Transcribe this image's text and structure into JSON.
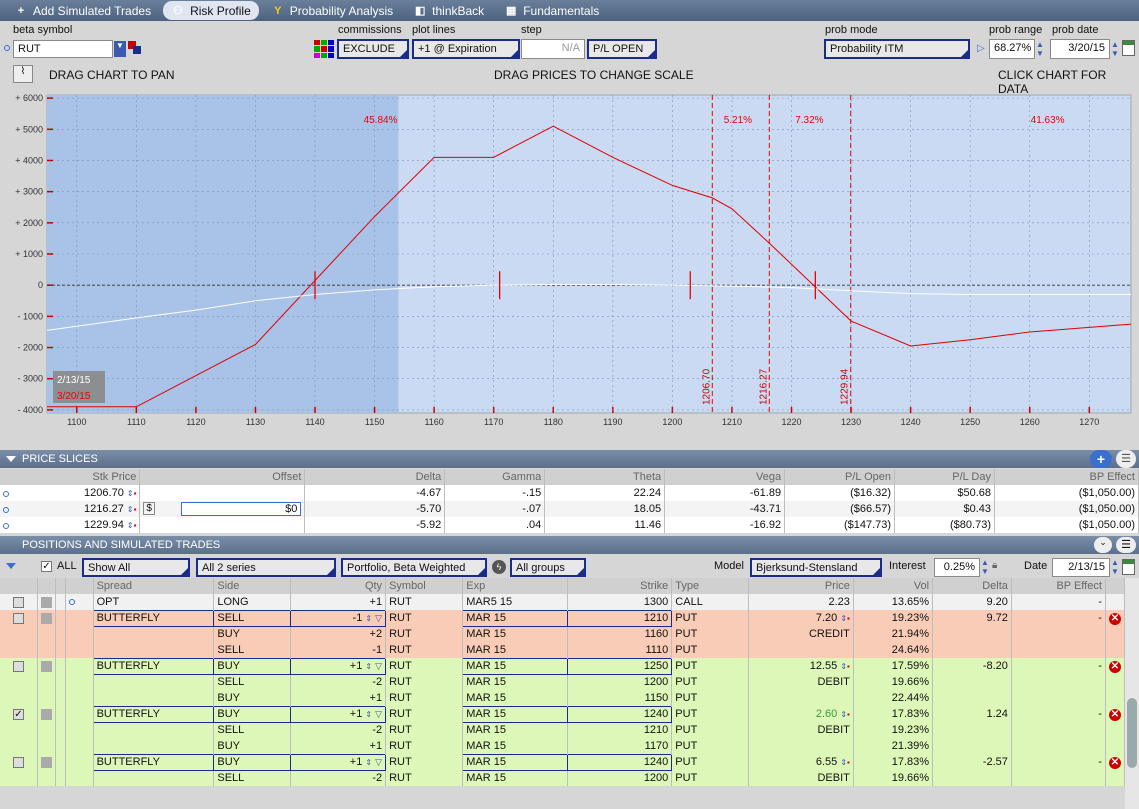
{
  "tabs": [
    {
      "label": "Add Simulated Trades",
      "icon": "plus-icon"
    },
    {
      "label": "Risk Profile",
      "icon": "risk-profile-icon"
    },
    {
      "label": "Probability Analysis",
      "icon": "probability-icon"
    },
    {
      "label": "thinkBack",
      "icon": "thinkback-icon"
    },
    {
      "label": "Fundamentals",
      "icon": "fundamentals-icon"
    }
  ],
  "controls": {
    "beta_symbol_label": "beta symbol",
    "beta_symbol": "RUT",
    "commissions_label": "commissions",
    "commissions": "EXCLUDE",
    "plot_lines_label": "plot lines",
    "plot_lines": "+1 @ Expiration",
    "step_label": "step",
    "step": "N/A",
    "pl_mode": "P/L OPEN",
    "prob_mode_label": "prob mode",
    "prob_mode": "Probability ITM",
    "prob_range_label": "prob range",
    "prob_range": "68.27%",
    "prob_date_label": "prob date",
    "prob_date": "3/20/15"
  },
  "chart_header": {
    "left": "DRAG CHART TO PAN",
    "center": "DRAG PRICES TO CHANGE SCALE",
    "right": "CLICK CHART FOR DATA"
  },
  "chart_data": {
    "type": "line",
    "xlim": [
      1095,
      1277
    ],
    "ylim": [
      -4100,
      6100
    ],
    "x_ticks": [
      1100,
      1110,
      1120,
      1130,
      1140,
      1150,
      1160,
      1170,
      1180,
      1190,
      1200,
      1210,
      1220,
      1230,
      1240,
      1250,
      1260,
      1270
    ],
    "y_ticks": [
      {
        "v": 6000,
        "t": "+ 6000"
      },
      {
        "v": 5000,
        "t": "+ 5000"
      },
      {
        "v": 4000,
        "t": "+ 4000"
      },
      {
        "v": 3000,
        "t": "+ 3000"
      },
      {
        "v": 2000,
        "t": "+ 2000"
      },
      {
        "v": 1000,
        "t": "+ 1000"
      },
      {
        "v": 0,
        "t": "0"
      },
      {
        "v": -1000,
        "t": "- 1000"
      },
      {
        "v": -2000,
        "t": "- 2000"
      },
      {
        "v": -3000,
        "t": "- 3000"
      },
      {
        "v": -4000,
        "t": "- 4000"
      }
    ],
    "series": [
      {
        "color": "#e00000",
        "x": [
          1095,
          1110,
          1130,
          1140,
          1150,
          1160,
          1170,
          1180,
          1190,
          1200,
          1206.7,
          1210,
          1216.27,
          1230,
          1240,
          1250,
          1260,
          1277
        ],
        "y": [
          -3900,
          -3900,
          -1900,
          150,
          2200,
          4100,
          4100,
          5100,
          4100,
          3200,
          2800,
          2450,
          1350,
          -1150,
          -1950,
          -1750,
          -1500,
          -1250
        ]
      },
      {
        "color": "#ffffff",
        "x": [
          1095,
          1110,
          1120,
          1130,
          1140,
          1150,
          1160,
          1170,
          1180,
          1190,
          1200,
          1210,
          1220,
          1230,
          1240,
          1250,
          1260,
          1277
        ],
        "y": [
          -1450,
          -1050,
          -800,
          -500,
          -300,
          -150,
          -50,
          0,
          20,
          20,
          0,
          -30,
          -80,
          -180,
          -270,
          -300,
          -300,
          -300
        ]
      }
    ],
    "prob_labels": [
      {
        "x": 1151,
        "t": "45.84%"
      },
      {
        "x": 1211,
        "t": "5.21%"
      },
      {
        "x": 1223,
        "t": "7.32%"
      },
      {
        "x": 1263,
        "t": "41.63%"
      }
    ],
    "vlines": [
      {
        "x": 1206.7,
        "t": "1206.70"
      },
      {
        "x": 1216.27,
        "t": "1216.27"
      },
      {
        "x": 1229.94,
        "t": "1229.94"
      }
    ],
    "ticks_on_zero": [
      1140,
      1171,
      1203,
      1224
    ],
    "shade_end": 1154,
    "date_labels": [
      "2/13/15",
      "3/20/15"
    ]
  },
  "price_slices": {
    "title": "PRICE SLICES",
    "columns": [
      "Stk Price",
      "Offset",
      "Delta",
      "Gamma",
      "Theta",
      "Vega",
      "P/L Open",
      "P/L Day",
      "BP Effect"
    ],
    "rows": [
      [
        "1206.70",
        "",
        "-4.67",
        "-.15",
        "22.24",
        "-61.89",
        "($16.32)",
        "$50.68",
        "($1,050.00)"
      ],
      [
        "1216.27",
        "$0",
        "-5.70",
        "-.07",
        "18.05",
        "-43.71",
        "($66.57)",
        "$0.43",
        "($1,050.00)"
      ],
      [
        "1229.94",
        "",
        "-5.92",
        ".04",
        "11.46",
        "-16.92",
        "($147.73)",
        "($80.73)",
        "($1,050.00)"
      ]
    ]
  },
  "positions": {
    "title": "POSITIONS AND SIMULATED TRADES",
    "all_label": "ALL",
    "show": "Show All",
    "series": "All 2 series",
    "portfolio": "Portfolio, Beta Weighted",
    "groups": "All groups",
    "model_label": "Model",
    "model": "Bjerksund-Stensland",
    "interest_label": "Interest",
    "interest": "0.25%",
    "date_label": "Date",
    "date": "2/13/15",
    "columns": [
      "Spread",
      "Side",
      "Qty",
      "Symbol",
      "Exp",
      "Strike",
      "Type",
      "Price",
      "Vol",
      "Delta",
      "BP Effect"
    ],
    "rows": [
      {
        "style": "white",
        "spread": "OPT",
        "side": "LONG",
        "qty": "+1",
        "symbol": "RUT",
        "exp": "MAR5 15",
        "strike": "1300",
        "type": "CALL",
        "price": "2.23",
        "vol": "13.65%",
        "delta": "9.20",
        "bp": "-"
      },
      {
        "style": "salmon",
        "spread": "BUTTERFLY",
        "side": "SELL",
        "qty": "-1",
        "symbol": "RUT",
        "exp": "MAR 15",
        "strike": "1210",
        "type": "PUT",
        "price": "7.20",
        "vol": "19.23%",
        "delta": "9.72",
        "bp": "-",
        "first": true
      },
      {
        "style": "salmon",
        "spread": "",
        "side": "BUY",
        "qty": "+2",
        "symbol": "RUT",
        "exp": "MAR 15",
        "strike": "1160",
        "type": "PUT",
        "price": "CREDIT",
        "vol": "21.94%",
        "delta": "",
        "bp": ""
      },
      {
        "style": "salmon",
        "spread": "",
        "side": "SELL",
        "qty": "-1",
        "symbol": "RUT",
        "exp": "MAR 15",
        "strike": "1110",
        "type": "PUT",
        "price": "",
        "vol": "24.64%",
        "delta": "",
        "bp": ""
      },
      {
        "style": "green",
        "spread": "BUTTERFLY",
        "side": "BUY",
        "qty": "+1",
        "symbol": "RUT",
        "exp": "MAR 15",
        "strike": "1250",
        "type": "PUT",
        "price": "12.55",
        "vol": "17.59%",
        "delta": "-8.20",
        "bp": "-",
        "first": true
      },
      {
        "style": "green",
        "spread": "",
        "side": "SELL",
        "qty": "-2",
        "symbol": "RUT",
        "exp": "MAR 15",
        "strike": "1200",
        "type": "PUT",
        "price": "DEBIT",
        "vol": "19.66%",
        "delta": "",
        "bp": ""
      },
      {
        "style": "green",
        "spread": "",
        "side": "BUY",
        "qty": "+1",
        "symbol": "RUT",
        "exp": "MAR 15",
        "strike": "1150",
        "type": "PUT",
        "price": "",
        "vol": "22.44%",
        "delta": "",
        "bp": ""
      },
      {
        "style": "green",
        "spread": "BUTTERFLY",
        "side": "BUY",
        "qty": "+1",
        "symbol": "RUT",
        "exp": "MAR 15",
        "strike": "1240",
        "type": "PUT",
        "price": "2.60",
        "vol": "17.83%",
        "delta": "1.24",
        "bp": "-",
        "first": true,
        "checked": true,
        "pricegreen": true
      },
      {
        "style": "green",
        "spread": "",
        "side": "SELL",
        "qty": "-2",
        "symbol": "RUT",
        "exp": "MAR 15",
        "strike": "1210",
        "type": "PUT",
        "price": "DEBIT",
        "vol": "19.23%",
        "delta": "",
        "bp": ""
      },
      {
        "style": "green",
        "spread": "",
        "side": "BUY",
        "qty": "+1",
        "symbol": "RUT",
        "exp": "MAR 15",
        "strike": "1170",
        "type": "PUT",
        "price": "",
        "vol": "21.39%",
        "delta": "",
        "bp": ""
      },
      {
        "style": "green",
        "spread": "BUTTERFLY",
        "side": "BUY",
        "qty": "+1",
        "symbol": "RUT",
        "exp": "MAR 15",
        "strike": "1240",
        "type": "PUT",
        "price": "6.55",
        "vol": "17.83%",
        "delta": "-2.57",
        "bp": "-",
        "first": true
      },
      {
        "style": "green",
        "spread": "",
        "side": "SELL",
        "qty": "-2",
        "symbol": "RUT",
        "exp": "MAR 15",
        "strike": "1200",
        "type": "PUT",
        "price": "DEBIT",
        "vol": "19.66%",
        "delta": "",
        "bp": ""
      }
    ]
  }
}
